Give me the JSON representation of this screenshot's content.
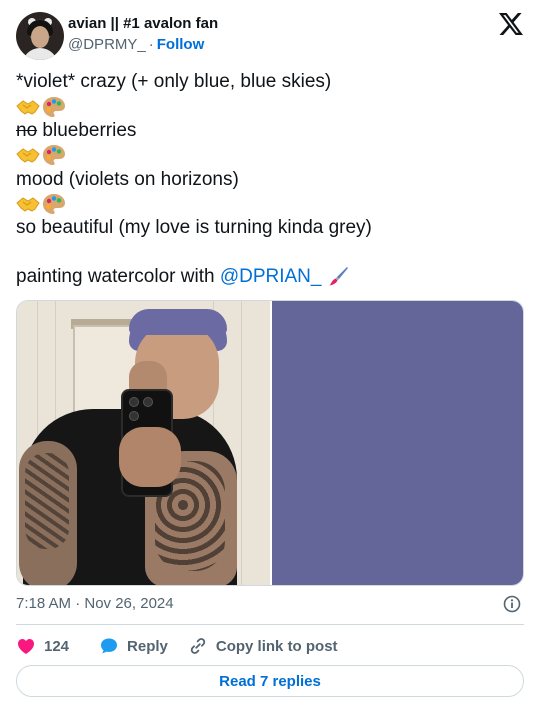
{
  "author": {
    "name": "avian || #1 avalon fan",
    "handle": "@DPRMY_",
    "separator": "·",
    "follow_label": "Follow"
  },
  "brand_icon": "x-logo-icon",
  "tweet": {
    "lines": [
      "*violet* crazy (+ only blue, blue skies)",
      "no",
      " blueberries",
      "mood (violets on horizons)",
      "so beautiful (my love is turning kinda grey)",
      "painting watercolor with ",
      "@DPRIAN_"
    ],
    "emoji_pair": [
      "handshake-emoji",
      "artist-palette-emoji"
    ],
    "trailing_emoji": "paintbrush-emoji"
  },
  "media": {
    "photo": "mirror-selfie-photo",
    "swatch_color": "#64669a"
  },
  "meta": {
    "timestamp": "7:18 AM · Nov 26, 2024"
  },
  "actions": {
    "like_count": "124",
    "reply_label": "Reply",
    "copy_label": "Copy link to post"
  },
  "read_replies_label": "Read 7 replies",
  "colors": {
    "accent": "#006fd6",
    "like": "#f91880",
    "reply": "#1d9bf0",
    "secondary_text": "#536471",
    "border": "#cfd9de"
  }
}
